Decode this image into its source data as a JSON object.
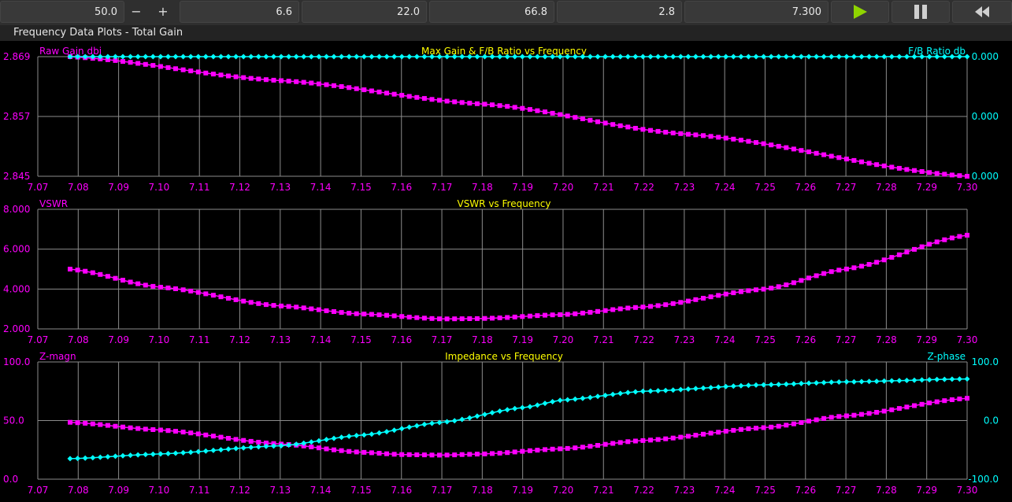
{
  "toolbar": {
    "impedance_value": "50.0",
    "minus_label": "−",
    "plus_label": "+",
    "fields": [
      "6.6",
      "22.0",
      "66.8",
      "2.8",
      "7.300"
    ],
    "play_icon": "play-icon",
    "pause_icon": "pause-icon",
    "rewind_icon": "rewind-icon"
  },
  "panel_title": "Frequency Data Plots - Total Gain",
  "colors": {
    "background": "#000000",
    "grid": "#8c8c8c",
    "magenta": "#ff00ff",
    "cyan": "#00ffff",
    "title_yellow": "#ffff00",
    "axis_text": "#ff00ff"
  },
  "chart_data": [
    {
      "type": "line",
      "title": "Max Gain & F/B Ratio vs Frequency",
      "ylabel": "Raw Gain dbi",
      "y2label": "F/B Ratio db",
      "xlim": [
        7.07,
        7.3
      ],
      "x_ticks": [
        "7.07",
        "7.08",
        "7.09",
        "7.10",
        "7.11",
        "7.12",
        "7.13",
        "7.14",
        "7.15",
        "7.16",
        "7.17",
        "7.18",
        "7.19",
        "7.20",
        "7.21",
        "7.22",
        "7.23",
        "7.24",
        "7.25",
        "7.26",
        "7.27",
        "7.28",
        "7.29",
        "7.30"
      ],
      "ylim": [
        2.845,
        2.869
      ],
      "y_ticks": [
        "2.869",
        "2.857",
        "2.845"
      ],
      "y2lim": [
        -1,
        0
      ],
      "y2_ticks": [
        "0.000",
        "0.000",
        "0.000"
      ],
      "grid": true,
      "series": [
        {
          "name": "Raw Gain dbi",
          "color": "magenta",
          "marker": "square",
          "x_start": 7.078,
          "x_end": 7.3,
          "points": 120,
          "knots": [
            [
              7.078,
              2.869
            ],
            [
              7.13,
              2.8642
            ],
            [
              7.18,
              2.8595
            ],
            [
              7.23,
              2.8535
            ],
            [
              7.3,
              2.845
            ]
          ]
        },
        {
          "name": "F/B Ratio db",
          "color": "cyan",
          "marker": "diamond",
          "axis": "right",
          "x_start": 7.078,
          "x_end": 7.3,
          "points": 120,
          "knots": [
            [
              7.078,
              0.0
            ],
            [
              7.3,
              0.0
            ]
          ]
        }
      ]
    },
    {
      "type": "line",
      "title": "VSWR vs Frequency",
      "ylabel": "VSWR",
      "xlim": [
        7.07,
        7.3
      ],
      "x_ticks": [
        "7.07",
        "7.08",
        "7.09",
        "7.10",
        "7.11",
        "7.12",
        "7.13",
        "7.14",
        "7.15",
        "7.16",
        "7.17",
        "7.18",
        "7.19",
        "7.20",
        "7.21",
        "7.22",
        "7.23",
        "7.24",
        "7.25",
        "7.26",
        "7.27",
        "7.28",
        "7.29",
        "7.30"
      ],
      "ylim": [
        2.0,
        8.0
      ],
      "y_ticks": [
        "8.000",
        "6.000",
        "4.000",
        "2.000"
      ],
      "grid": true,
      "series": [
        {
          "name": "VSWR",
          "color": "magenta",
          "marker": "square",
          "x_start": 7.078,
          "x_end": 7.3,
          "points": 120,
          "knots": [
            [
              7.078,
              5.0
            ],
            [
              7.1,
              4.1
            ],
            [
              7.13,
              3.15
            ],
            [
              7.15,
              2.75
            ],
            [
              7.17,
              2.5
            ],
            [
              7.18,
              2.52
            ],
            [
              7.2,
              2.72
            ],
            [
              7.22,
              3.1
            ],
            [
              7.25,
              4.0
            ],
            [
              7.27,
              5.0
            ],
            [
              7.3,
              6.7
            ]
          ]
        }
      ]
    },
    {
      "type": "line",
      "title": "Impedance vs Frequency",
      "ylabel": "Z-magn",
      "y2label": "Z-phase",
      "xlim": [
        7.07,
        7.3
      ],
      "x_ticks": [
        "7.07",
        "7.08",
        "7.09",
        "7.10",
        "7.11",
        "7.12",
        "7.13",
        "7.14",
        "7.15",
        "7.16",
        "7.17",
        "7.18",
        "7.19",
        "7.20",
        "7.21",
        "7.22",
        "7.23",
        "7.24",
        "7.25",
        "7.26",
        "7.27",
        "7.28",
        "7.29",
        "7.30"
      ],
      "ylim": [
        0,
        100
      ],
      "y_ticks": [
        "100.0",
        "50.0",
        "0.0"
      ],
      "y2lim": [
        -100,
        100
      ],
      "y2_ticks": [
        "100.0",
        "0.0",
        "-100.0"
      ],
      "grid": true,
      "series": [
        {
          "name": "Z-magn",
          "color": "magenta",
          "marker": "square",
          "x_start": 7.078,
          "x_end": 7.3,
          "points": 120,
          "knots": [
            [
              7.078,
              48.5
            ],
            [
              7.1,
              42
            ],
            [
              7.13,
              30
            ],
            [
              7.15,
              23
            ],
            [
              7.16,
              21
            ],
            [
              7.17,
              20.5
            ],
            [
              7.18,
              21.5
            ],
            [
              7.2,
              26
            ],
            [
              7.22,
              33
            ],
            [
              7.25,
              44
            ],
            [
              7.27,
              54
            ],
            [
              7.3,
              69
            ]
          ]
        },
        {
          "name": "Z-phase",
          "color": "cyan",
          "marker": "diamond",
          "axis": "right",
          "x_start": 7.078,
          "x_end": 7.3,
          "points": 120,
          "knots": [
            [
              7.078,
              -65
            ],
            [
              7.1,
              -57
            ],
            [
              7.13,
              -43
            ],
            [
              7.15,
              -25
            ],
            [
              7.17,
              -3
            ],
            [
              7.19,
              22
            ],
            [
              7.2,
              35
            ],
            [
              7.22,
              50
            ],
            [
              7.25,
              61
            ],
            [
              7.27,
              66
            ],
            [
              7.3,
              71
            ]
          ]
        }
      ]
    }
  ]
}
